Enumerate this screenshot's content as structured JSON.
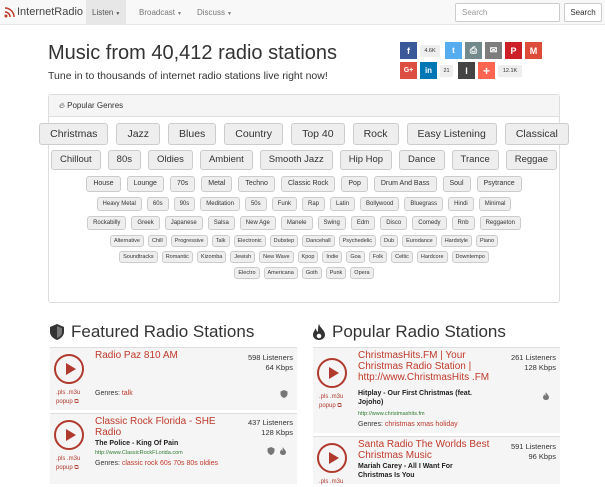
{
  "nav": {
    "brand": "InternetRadio",
    "listen": "Listen",
    "broadcast": "Broadcast",
    "discuss": "Discuss",
    "search_placeholder": "Search",
    "search_button": "Search"
  },
  "hero": {
    "title": "Music from 40,412 radio stations",
    "subtitle": "Tune in to thousands of internet radio stations live right now!"
  },
  "share": {
    "facebook_count": "4.6K",
    "google_count": "21",
    "total_count": "12.1K",
    "colors": {
      "facebook": "#3b5998",
      "twitter": "#55acee",
      "print": "#738a8d",
      "email": "#7d7d7d",
      "pinterest": "#cb2027",
      "gmail": "#dd4b39",
      "googleplus": "#dc4e41",
      "linkedin": "#0077b5",
      "instapaper": "#444444",
      "more": "#ff6550"
    }
  },
  "genres": {
    "heading": "Popular Genres",
    "row1": [
      "Christmas",
      "Jazz",
      "Blues",
      "Country",
      "Top 40",
      "Rock",
      "Easy Listening",
      "Classical"
    ],
    "row2": [
      "Chillout",
      "80s",
      "Oldies",
      "Ambient",
      "Smooth Jazz",
      "Hip Hop",
      "Dance",
      "Trance",
      "Reggae"
    ],
    "row3": [
      "House",
      "Lounge",
      "70s",
      "Metal",
      "Techno",
      "Classic Rock",
      "Pop",
      "Drum And Bass",
      "Soul",
      "Psytrance"
    ],
    "row4": [
      "Heavy Metal",
      "60s",
      "90s",
      "Meditation",
      "50s",
      "Funk",
      "Rap",
      "Latin",
      "Bollywood",
      "Bluegrass",
      "Hindi",
      "Minimal"
    ],
    "row5": [
      "Rockabilly",
      "Greek",
      "Japanese",
      "Salsa",
      "New Age",
      "Manele",
      "Swing",
      "Edm",
      "Disco",
      "Comedy",
      "Rnb",
      "Reggaeton"
    ],
    "row6": [
      "Alternative",
      "Chill",
      "Progressive",
      "Talk",
      "Electronic",
      "Dubstep",
      "Dancehall",
      "Psychedelic",
      "Dub",
      "Eurodance",
      "Hardstyle",
      "Piano"
    ],
    "row7": [
      "Soundtracks",
      "Romantic",
      "Kizomba",
      "Jewish",
      "New Wave",
      "Kpop",
      "Indie",
      "Goa",
      "Folk",
      "Celtic",
      "Hardcore",
      "Downtempo"
    ],
    "row8": [
      "Electro",
      "Americana",
      "Goth",
      "Punk",
      "Opera"
    ]
  },
  "featured": {
    "heading": "Featured Radio Stations",
    "stations": [
      {
        "name": "Radio Paz 810 AM",
        "listeners": "598 Listeners",
        "bitrate": "64 Kbps",
        "genres_label": "Genres:",
        "genres": "talk",
        "pls": ".pls",
        "m3u": ".m3u",
        "popup": "popup"
      },
      {
        "name": "Classic Rock Florida - SHE Radio",
        "listeners": "437 Listeners",
        "bitrate": "128 Kbps",
        "song": "The Police - King Of Pain",
        "url": "http://www.ClassicRockFLorida.com",
        "genres_label": "Genres:",
        "genres": "classic rock 60s 70s 80s oldies",
        "pls": ".pls",
        "m3u": ".m3u",
        "popup": "popup"
      }
    ]
  },
  "popular": {
    "heading": "Popular Radio Stations",
    "stations": [
      {
        "name": "ChristmasHits.FM | Your Christmas Radio Station | http://www.ChristmasHits .FM",
        "listeners": "261 Listeners",
        "bitrate": "128 Kbps",
        "song": "Hitplay - Our First Christmas (feat. Jojoho)",
        "url": "http://www.christmashits.fm",
        "genres_label": "Genres:",
        "genres": "christmas xmas holiday",
        "pls": ".pls",
        "m3u": ".m3u",
        "popup": "popup"
      },
      {
        "name": "Santa Radio The Worlds Best Christmas Music",
        "listeners": "591 Listeners",
        "bitrate": "96 Kbps",
        "song": "Mariah Carey - All I Want For Christmas Is You",
        "pls": ".pls",
        "m3u": ".m3u"
      }
    ]
  }
}
